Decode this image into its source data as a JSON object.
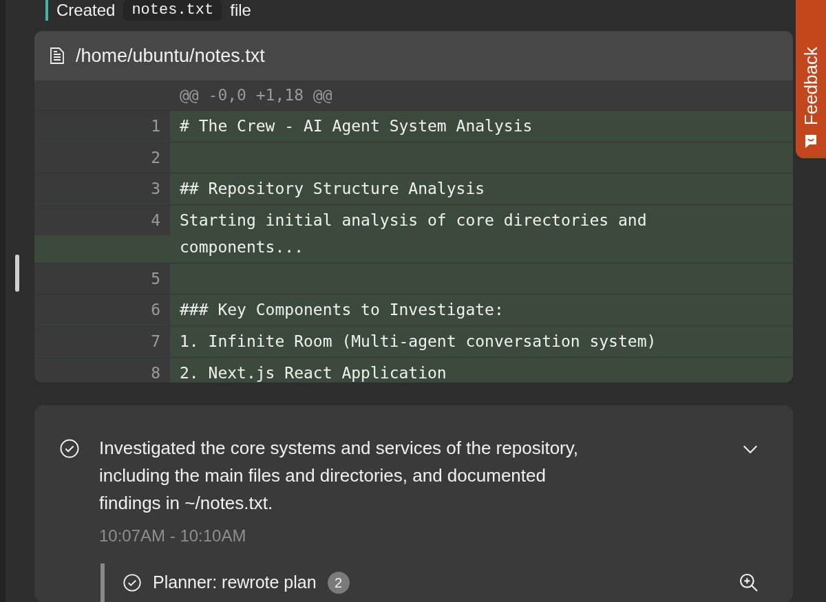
{
  "header_line": {
    "text": "Created",
    "code": "notes.txt",
    "suffix": "file"
  },
  "feedback_tab": {
    "label": "Feedback"
  },
  "diff": {
    "file_path": "/home/ubuntu/notes.txt",
    "hunk": "@@ -0,0 +1,18 @@",
    "lines": [
      {
        "number": "1",
        "text": "# The Crew - AI Agent System Analysis",
        "kind": "added"
      },
      {
        "number": "2",
        "kind": "added"
      },
      {
        "number": "3",
        "text": "## Repository Structure Analysis",
        "kind": "added"
      },
      {
        "number": "4",
        "text": "Starting initial analysis of core directories and components...",
        "kind": "added"
      },
      {
        "number": "5",
        "kind": "added"
      },
      {
        "number": "6",
        "text": "### Key Components to Investigate:",
        "kind": "added"
      },
      {
        "number": "7",
        "text": "1. Infinite Room (Multi-agent conversation system)",
        "kind": "added"
      },
      {
        "number": "8",
        "text": "2. Next.js React Application",
        "kind": "added"
      }
    ]
  },
  "step": {
    "done": true,
    "expanded": true,
    "summary": "Investigated the core systems and services of the repository, including the main files and directories, and documented findings in ~/notes.txt.",
    "time": "10:07AM - 10:10AM",
    "substeps": [
      {
        "done": true,
        "label": "Planner: rewrote plan",
        "count": "2"
      }
    ]
  }
}
